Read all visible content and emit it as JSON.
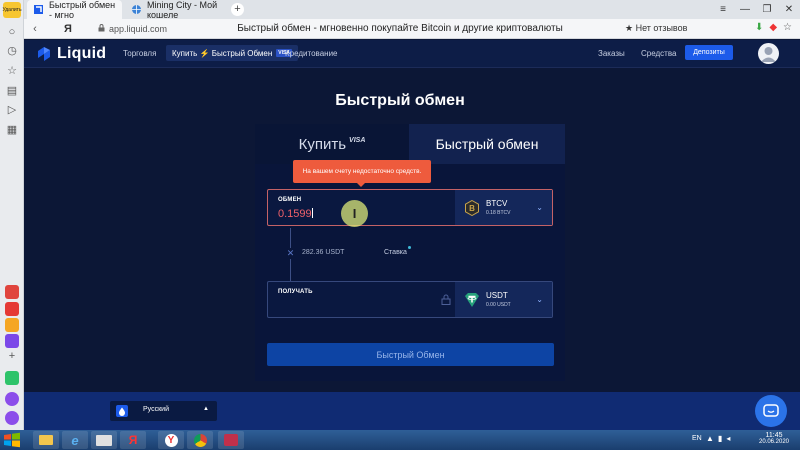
{
  "browser": {
    "tabs": [
      {
        "title": "Быстрый обмен - мгно",
        "active": true
      },
      {
        "title": "Mining City - Мой кошеле",
        "active": false
      }
    ],
    "nav_logo_letter": "Я",
    "url": "app.liquid.com",
    "page_title": "Быстрый обмен - мгновенно покупайте Bitcoin и другие криптовалюты",
    "reviews_label": "★ Нет отзывов",
    "sidebar_badge": "Удалить"
  },
  "site": {
    "logo_text": "Liquid",
    "nav": {
      "trade": "Торговля",
      "buy": "Купить ⚡ Быстрый Обмен",
      "buy_badge": "VISA",
      "credit": "Кредитование",
      "orders": "Заказы",
      "funds": "Средства",
      "deposit": "Депозиты"
    }
  },
  "swap": {
    "heading": "Быстрый обмен",
    "tab_buy": "Купить",
    "tab_buy_badge": "VISA",
    "tab_swap": "Быстрый обмен",
    "error_tooltip": "На вашем счету недостаточно средств.",
    "from": {
      "label": "ОБМЕН",
      "value": "0.1599",
      "currency": "BTCV",
      "balance": "0.18 BTCV"
    },
    "rate": {
      "value": "282.36 USDT",
      "label": "Ставка"
    },
    "to": {
      "label": "ПОЛУЧАТЬ",
      "value": "",
      "currency": "USDT",
      "balance": "0.00 USDT"
    },
    "submit": "Быстрый Обмен"
  },
  "footer": {
    "language": "Русский"
  },
  "taskbar": {
    "lang": "EN",
    "time": "11:45",
    "date": "20.06.2020"
  },
  "colors": {
    "page_bg": "#0c1736",
    "accent_blue": "#1c5bea",
    "error": "#ee5b3d",
    "error_value": "#f0616a"
  }
}
